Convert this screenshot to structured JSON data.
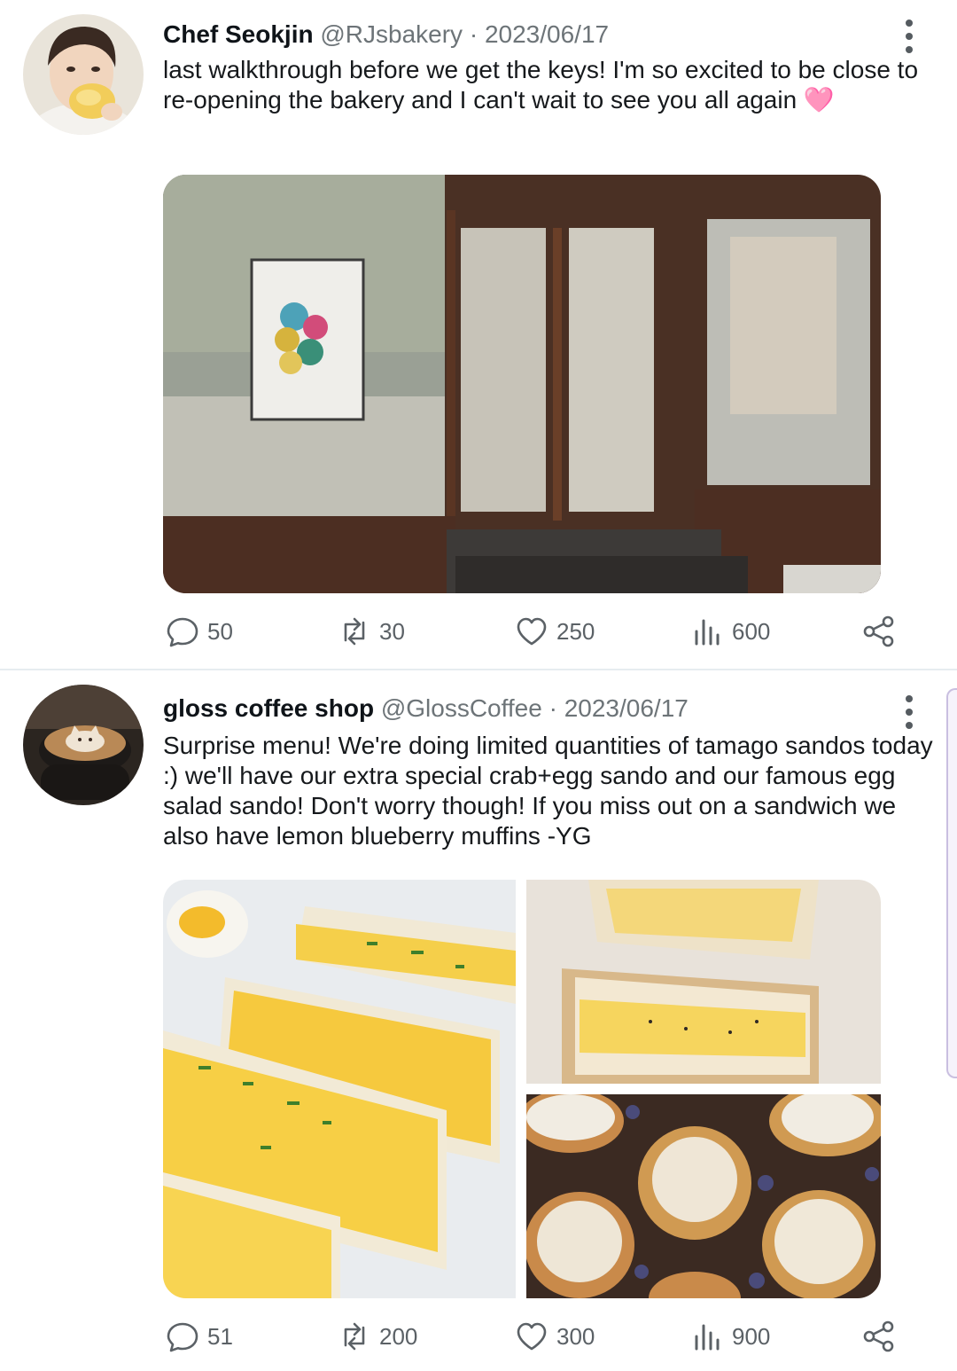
{
  "tweets": [
    {
      "name": "Chef Seokjin",
      "handle": "@RJsbakery",
      "separator": "·",
      "date": "2023/06/17",
      "text": "last walkthrough before we get the keys! I'm so excited to be close to re-opening the bakery and I can't wait to see you all again 🩷",
      "avatar_icon": "person-eating-icon",
      "media": [
        "storefront-photo"
      ],
      "stats": {
        "replies": "50",
        "retweets": "30",
        "likes": "250",
        "views": "600"
      }
    },
    {
      "name": "gloss coffee shop",
      "handle": "@GlossCoffee",
      "separator": "·",
      "date": "2023/06/17",
      "text": "Surprise menu! We're doing limited quantities of tamago sandos today :) we'll have our extra special crab+egg sando and our famous egg salad sando! Don't worry though! If you miss out on a sandwich we also have lemon blueberry muffins -YG",
      "avatar_icon": "latte-art-icon",
      "media": [
        "egg-sandwich-photo",
        "wrapped-sando-photo",
        "blueberry-muffins-photo"
      ],
      "stats": {
        "replies": "51",
        "retweets": "200",
        "likes": "300",
        "views": "900"
      }
    }
  ],
  "colors": {
    "text": "#0f1419",
    "muted": "#6d7478",
    "icon": "#5b6166",
    "divider": "#e6ecf0",
    "scrollbar": "#c9bfe0"
  }
}
